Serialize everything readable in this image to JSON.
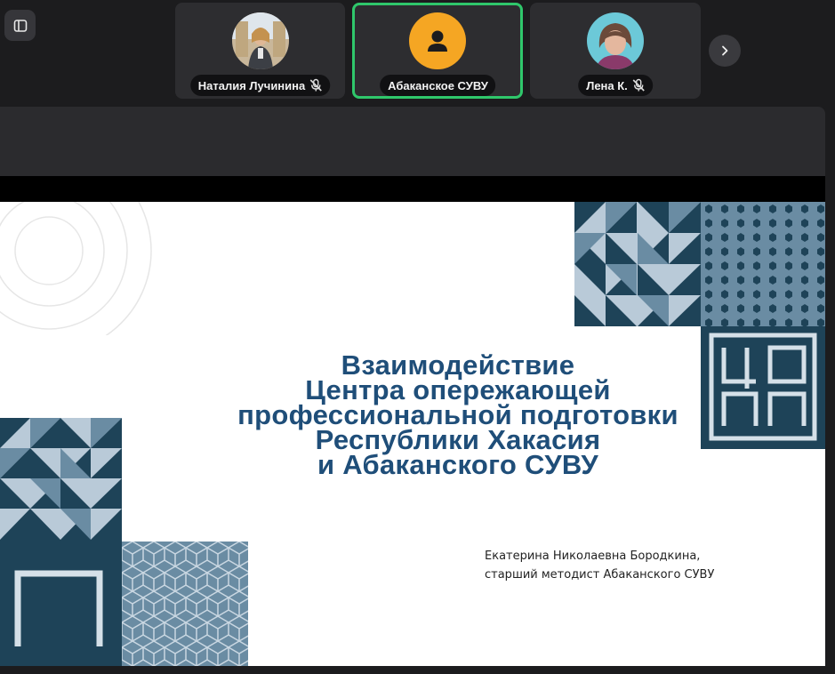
{
  "toolbar": {
    "sidebar_toggle_icon": "sidebar-panel-icon",
    "next_icon": "chevron-right-icon"
  },
  "participants": [
    {
      "name": "Наталия Лучинина",
      "muted": true,
      "active": false,
      "avatar": "photo"
    },
    {
      "name": "Абаканское СУВУ",
      "muted": false,
      "active": true,
      "avatar": "default-user-icon"
    },
    {
      "name": "Лена К.",
      "muted": true,
      "active": false,
      "avatar": "photo"
    }
  ],
  "colors": {
    "active_border": "#2fc76b",
    "default_avatar": "#f5a623",
    "slide_title": "#1f4e79",
    "pattern_dark": "#1e4358",
    "pattern_light": "#b9cad8"
  },
  "slide": {
    "title_lines": [
      "Взаимодействие",
      "Центра опережающей",
      "профессиональной подготовки",
      "Республики Хакасия",
      "и Абаканского СУВУ"
    ],
    "author_lines": [
      "Екатерина Николаевна Бородкина,",
      "старший методист Абаканского СУВУ"
    ],
    "logo_text": "ЦОПП"
  }
}
